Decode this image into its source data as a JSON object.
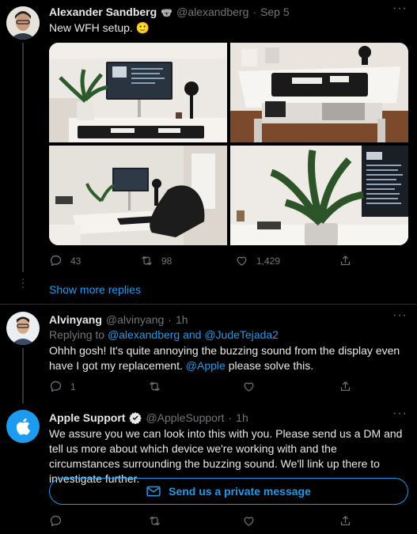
{
  "tweet1": {
    "author": "Alexander Sandberg",
    "badge_emoji": "🐨",
    "handle": "@alexandberg",
    "separator": "·",
    "date": "Sep 5",
    "text": "New WFH setup. 🙂",
    "stats": {
      "replies": "43",
      "retweets": "98",
      "likes": "1,429"
    }
  },
  "show_more_replies": "Show more replies",
  "reply1": {
    "author": "Alvinyang",
    "handle": "@alvinyang",
    "separator": "·",
    "time": "1h",
    "replying_prefix": "Replying to",
    "replying_users": "@alexandberg and @JudeTejada2",
    "text_part1": "Ohhh gosh! It's quite annoying the buzzing sound from the display even have I got my replacement.",
    "mention": "@Apple",
    "text_part2": "please solve this.",
    "stats": {
      "replies": "1"
    }
  },
  "reply2": {
    "author": "Apple Support",
    "handle": "@AppleSupport",
    "separator": "·",
    "time": "1h",
    "text": "We assure you we can look into this with you. Please send us a DM and tell us more about which device we're working with and the circumstances surrounding the buzzing sound. We'll link up there to investigate further.",
    "dm_button": "Send us a private message"
  },
  "icons": [
    "reply-icon",
    "retweet-icon",
    "like-icon",
    "share-icon",
    "more-icon",
    "verified-icon",
    "mail-icon",
    "apple-logo-icon"
  ],
  "colors": {
    "background": "#000000",
    "text": "#e7e9ea",
    "muted": "#71767b",
    "accent": "#1d9bf0",
    "apple_avatar": "#1d9bf0"
  }
}
